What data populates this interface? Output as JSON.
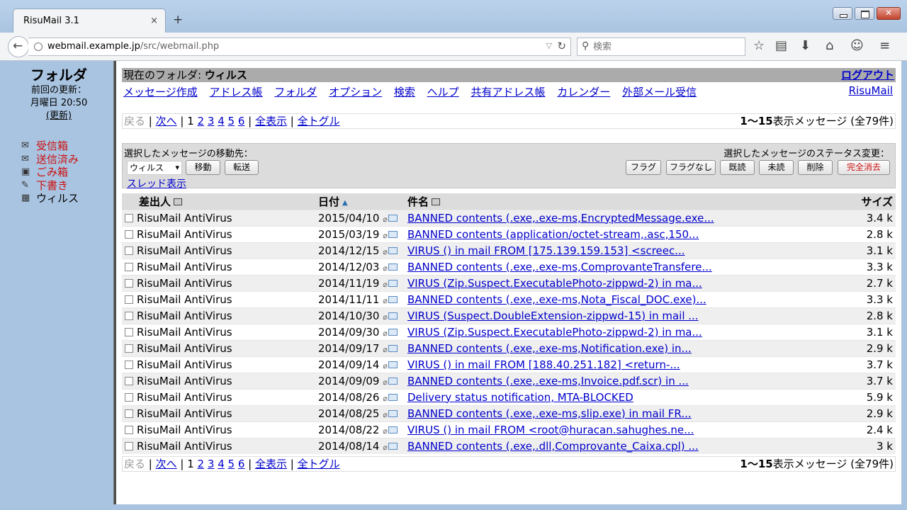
{
  "browser": {
    "tab_title": "RisuMail 3.1",
    "tab_close": "×",
    "new_tab": "+",
    "url_host": "webmail.example.jp",
    "url_path": "/src/webmail.php",
    "search_placeholder": "検索"
  },
  "sidebar": {
    "title": "フォルダ",
    "last_update_label": "前回の更新：",
    "last_update_value": "月曜日 20:50",
    "refresh_label": "(更新)",
    "folders": [
      {
        "label": "受信箱",
        "icon": "inbox-icon",
        "color": "#cc1111"
      },
      {
        "label": "送信済み",
        "icon": "sent-icon",
        "color": "#cc1111"
      },
      {
        "label": "ごみ箱",
        "icon": "trash-icon",
        "color": "#cc1111"
      },
      {
        "label": "下書き",
        "icon": "drafts-icon",
        "color": "#cc1111"
      },
      {
        "label": "ウィルス",
        "icon": "folder-icon",
        "color": "#000000"
      }
    ]
  },
  "header": {
    "current_folder_label": "現在のフォルダ:",
    "current_folder_name": "ウィルス",
    "logout": "ログアウト",
    "brand": "RisuMail"
  },
  "menu": [
    "メッセージ作成",
    "アドレス帳",
    "フォルダ",
    "オプション",
    "検索",
    "ヘルプ",
    "共有アドレス帳",
    "カレンダー",
    "外部メール受信"
  ],
  "pager": {
    "prev": "戻る",
    "next": "次へ",
    "current_page": "1",
    "pages": [
      "2",
      "3",
      "4",
      "5",
      "6"
    ],
    "show_all": "全表示",
    "toggle_all": "全トグル",
    "count_range": "1～15",
    "count_text": "表示メッセージ (全79件)"
  },
  "actions": {
    "move_label": "選択したメッセージの移動先：",
    "status_label": "選択したメッセージのステータス変更：",
    "folder_select_value": "ウィルス",
    "move_button": "移動",
    "forward_button": "転送",
    "thread_view": "スレッド表示",
    "flag": "フラグ",
    "unflag": "フラグなし",
    "read": "既読",
    "unread": "未読",
    "delete": "削除",
    "expunge": "完全消去"
  },
  "table": {
    "col_from": "差出人",
    "col_date": "日付",
    "col_subject": "件名",
    "col_size": "サイズ",
    "rows": [
      {
        "from": "RisuMail AntiVirus",
        "date": "2015/04/10",
        "subject": "BANNED contents (.exe,.exe-ms,EncryptedMessage.exe...",
        "size": "3.4 k"
      },
      {
        "from": "RisuMail AntiVirus",
        "date": "2015/03/19",
        "subject": "BANNED contents (application/octet-stream,.asc,150...",
        "size": "2.8 k"
      },
      {
        "from": "RisuMail AntiVirus",
        "date": "2014/12/15",
        "subject": "VIRUS () in mail FROM [175.139.159.153] <screec...",
        "size": "3.1 k"
      },
      {
        "from": "RisuMail AntiVirus",
        "date": "2014/12/03",
        "subject": "BANNED contents (.exe,.exe-ms,ComprovanteTransfere...",
        "size": "3.3 k"
      },
      {
        "from": "RisuMail AntiVirus",
        "date": "2014/11/19",
        "subject": "VIRUS (Zip.Suspect.ExecutablePhoto-zippwd-2) in ma...",
        "size": "2.7 k"
      },
      {
        "from": "RisuMail AntiVirus",
        "date": "2014/11/11",
        "subject": "BANNED contents (.exe,.exe-ms,Nota_Fiscal_DOC.exe)...",
        "size": "3.3 k"
      },
      {
        "from": "RisuMail AntiVirus",
        "date": "2014/10/30",
        "subject": "VIRUS (Suspect.DoubleExtension-zippwd-15) in mail ...",
        "size": "2.8 k"
      },
      {
        "from": "RisuMail AntiVirus",
        "date": "2014/09/30",
        "subject": "VIRUS (Zip.Suspect.ExecutablePhoto-zippwd-2) in ma...",
        "size": "3.1 k"
      },
      {
        "from": "RisuMail AntiVirus",
        "date": "2014/09/17",
        "subject": "BANNED contents (.exe,.exe-ms,Notification.exe) in...",
        "size": "2.9 k"
      },
      {
        "from": "RisuMail AntiVirus",
        "date": "2014/09/14",
        "subject": "VIRUS () in mail FROM [188.40.251.182] <return-...",
        "size": "3.7 k"
      },
      {
        "from": "RisuMail AntiVirus",
        "date": "2014/09/09",
        "subject": "BANNED contents (.exe,.exe-ms,Invoice.pdf.scr) in ...",
        "size": "3.7 k"
      },
      {
        "from": "RisuMail AntiVirus",
        "date": "2014/08/26",
        "subject": "Delivery status notification, MTA-BLOCKED",
        "size": "5.9 k"
      },
      {
        "from": "RisuMail AntiVirus",
        "date": "2014/08/25",
        "subject": "BANNED contents (.exe,.exe-ms,slip.exe) in mail FR...",
        "size": "2.9 k"
      },
      {
        "from": "RisuMail AntiVirus",
        "date": "2014/08/22",
        "subject": "VIRUS () in mail FROM <root@huracan.sahughes.ne...",
        "size": "2.4 k"
      },
      {
        "from": "RisuMail AntiVirus",
        "date": "2014/08/14",
        "subject": "BANNED contents (.exe,.dll,Comprovante_Caixa.cpl) ...",
        "size": "3 k"
      }
    ]
  }
}
